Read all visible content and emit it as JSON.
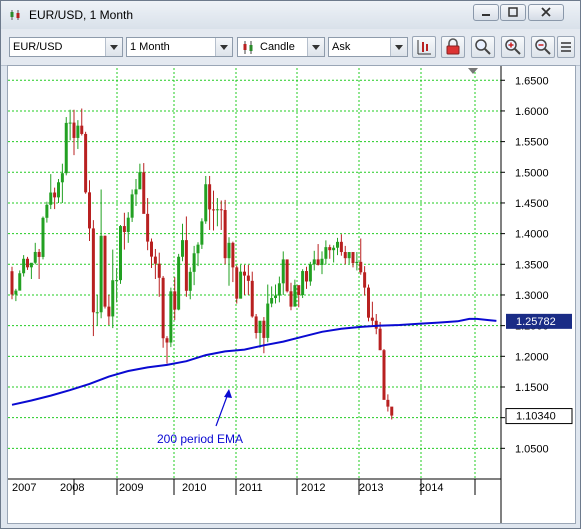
{
  "window": {
    "title": "EUR/USD,  1 Month"
  },
  "toolbar": {
    "instrument": "EUR/USD",
    "period": "1 Month",
    "chart_type": "Candle",
    "price_side": "Ask",
    "icons": [
      "candle-chart-icon",
      "lock-icon",
      "zoom-icon",
      "zoom-in-icon",
      "zoom-out-icon",
      "options-icon"
    ]
  },
  "colors": {
    "up": "#22a022",
    "down": "#b82020",
    "ema": "#0a0ad2",
    "grid": "#22cc22",
    "label_bg": "#1a2c86"
  },
  "chart_data": {
    "type": "candlestick",
    "instrument": "EUR/USD",
    "timeframe": "1 Month",
    "ylim": [
      1.0,
      1.67
    ],
    "yticks": [
      "1.6500",
      "1.6000",
      "1.5500",
      "1.5000",
      "1.4500",
      "1.4000",
      "1.3500",
      "1.3000",
      "1.2500",
      "1.2000",
      "1.1500",
      "1.1000",
      "1.0500"
    ],
    "xticks": [
      "2007",
      "2008",
      "2009",
      "2010",
      "2011",
      "2012",
      "2013",
      "2014"
    ],
    "grid": true,
    "current_price": "1.10340",
    "ema_value": "1.25782",
    "annotation": "200 period EMA",
    "candles": [
      [
        1.3387,
        1.346,
        1.293,
        1.3008
      ],
      [
        1.3008,
        1.31,
        1.29,
        1.3071
      ],
      [
        1.3071,
        1.34,
        1.31,
        1.3354
      ],
      [
        1.3354,
        1.365,
        1.33,
        1.359
      ],
      [
        1.359,
        1.362,
        1.341,
        1.3451
      ],
      [
        1.3451,
        1.352,
        1.326,
        1.3525
      ],
      [
        1.3525,
        1.385,
        1.35,
        1.3701
      ],
      [
        1.3701,
        1.375,
        1.326,
        1.362
      ],
      [
        1.362,
        1.428,
        1.358,
        1.4258
      ],
      [
        1.4258,
        1.452,
        1.418,
        1.447
      ],
      [
        1.447,
        1.497,
        1.44,
        1.467
      ],
      [
        1.467,
        1.475,
        1.44,
        1.4591
      ],
      [
        1.4591,
        1.489,
        1.45,
        1.4837
      ],
      [
        1.4837,
        1.514,
        1.45,
        1.4985
      ],
      [
        1.4985,
        1.59,
        1.495,
        1.5805
      ],
      [
        1.5805,
        1.602,
        1.552,
        1.581
      ],
      [
        1.581,
        1.602,
        1.528,
        1.556
      ],
      [
        1.556,
        1.585,
        1.538,
        1.576
      ],
      [
        1.576,
        1.604,
        1.56,
        1.5625
      ],
      [
        1.5625,
        1.566,
        1.465,
        1.4673
      ],
      [
        1.4673,
        1.487,
        1.388,
        1.4085
      ],
      [
        1.4085,
        1.422,
        1.233,
        1.2718
      ],
      [
        1.2718,
        1.3,
        1.25,
        1.2718
      ],
      [
        1.2718,
        1.472,
        1.262,
        1.3965
      ],
      [
        1.3965,
        1.397,
        1.278,
        1.281
      ],
      [
        1.281,
        1.3,
        1.251,
        1.265
      ],
      [
        1.265,
        1.374,
        1.246,
        1.324
      ],
      [
        1.324,
        1.344,
        1.288,
        1.3242
      ],
      [
        1.3242,
        1.414,
        1.318,
        1.4123
      ],
      [
        1.4123,
        1.434,
        1.374,
        1.4027
      ],
      [
        1.4027,
        1.435,
        1.385,
        1.426
      ],
      [
        1.426,
        1.472,
        1.419,
        1.464
      ],
      [
        1.464,
        1.489,
        1.445,
        1.4722
      ],
      [
        1.4722,
        1.514,
        1.473,
        1.5
      ],
      [
        1.5,
        1.515,
        1.44,
        1.4322
      ],
      [
        1.4322,
        1.458,
        1.373,
        1.387
      ],
      [
        1.387,
        1.392,
        1.344,
        1.3625
      ],
      [
        1.3625,
        1.375,
        1.326,
        1.351
      ],
      [
        1.351,
        1.369,
        1.297,
        1.328
      ],
      [
        1.328,
        1.331,
        1.214,
        1.2295
      ],
      [
        1.2295,
        1.233,
        1.188,
        1.2225
      ],
      [
        1.2225,
        1.312,
        1.215,
        1.3059
      ],
      [
        1.3059,
        1.329,
        1.259,
        1.2762
      ],
      [
        1.2762,
        1.367,
        1.275,
        1.3623
      ],
      [
        1.3623,
        1.416,
        1.355,
        1.3894
      ],
      [
        1.3894,
        1.428,
        1.297,
        1.3068
      ],
      [
        1.3068,
        1.345,
        1.293,
        1.3377
      ],
      [
        1.3377,
        1.38,
        1.316,
        1.368
      ],
      [
        1.368,
        1.386,
        1.347,
        1.382
      ],
      [
        1.382,
        1.425,
        1.375,
        1.42
      ],
      [
        1.42,
        1.494,
        1.416,
        1.4805
      ],
      [
        1.4805,
        1.494,
        1.406,
        1.4395
      ],
      [
        1.4395,
        1.47,
        1.405,
        1.439
      ],
      [
        1.439,
        1.458,
        1.412,
        1.4397
      ],
      [
        1.4397,
        1.454,
        1.406,
        1.4385
      ],
      [
        1.4385,
        1.455,
        1.35,
        1.36
      ],
      [
        1.36,
        1.394,
        1.315,
        1.385
      ],
      [
        1.385,
        1.387,
        1.321,
        1.345
      ],
      [
        1.345,
        1.348,
        1.286,
        1.294
      ],
      [
        1.294,
        1.349,
        1.295,
        1.338
      ],
      [
        1.338,
        1.349,
        1.3,
        1.3316
      ],
      [
        1.3316,
        1.349,
        1.3,
        1.323
      ],
      [
        1.323,
        1.338,
        1.263,
        1.265
      ],
      [
        1.265,
        1.269,
        1.229,
        1.238
      ],
      [
        1.238,
        1.244,
        1.214,
        1.258
      ],
      [
        1.258,
        1.264,
        1.205,
        1.23
      ],
      [
        1.23,
        1.317,
        1.223,
        1.286
      ],
      [
        1.286,
        1.314,
        1.28,
        1.295
      ],
      [
        1.295,
        1.317,
        1.286,
        1.299
      ],
      [
        1.299,
        1.33,
        1.288,
        1.319
      ],
      [
        1.319,
        1.371,
        1.3,
        1.358
      ],
      [
        1.358,
        1.347,
        1.304,
        1.306
      ],
      [
        1.306,
        1.32,
        1.275,
        1.281
      ],
      [
        1.281,
        1.325,
        1.282,
        1.316
      ],
      [
        1.316,
        1.311,
        1.28,
        1.3
      ],
      [
        1.3,
        1.342,
        1.295,
        1.339
      ],
      [
        1.339,
        1.346,
        1.31,
        1.322
      ],
      [
        1.322,
        1.354,
        1.315,
        1.35
      ],
      [
        1.35,
        1.372,
        1.34,
        1.358
      ],
      [
        1.358,
        1.383,
        1.348,
        1.349
      ],
      [
        1.349,
        1.371,
        1.334,
        1.359
      ],
      [
        1.359,
        1.389,
        1.35,
        1.378
      ],
      [
        1.378,
        1.382,
        1.359,
        1.373
      ],
      [
        1.373,
        1.381,
        1.353,
        1.377
      ],
      [
        1.377,
        1.393,
        1.365,
        1.3866
      ],
      [
        1.3866,
        1.399,
        1.364,
        1.37
      ],
      [
        1.37,
        1.38,
        1.35,
        1.36
      ],
      [
        1.36,
        1.365,
        1.351,
        1.37
      ],
      [
        1.37,
        1.37,
        1.345,
        1.352
      ],
      [
        1.352,
        1.37,
        1.34,
        1.354
      ],
      [
        1.354,
        1.392,
        1.333,
        1.337
      ],
      [
        1.337,
        1.347,
        1.299,
        1.312
      ],
      [
        1.312,
        1.317,
        1.257,
        1.263
      ],
      [
        1.263,
        1.289,
        1.25,
        1.258
      ],
      [
        1.258,
        1.269,
        1.236,
        1.245
      ],
      [
        1.245,
        1.256,
        1.21,
        1.21
      ],
      [
        1.21,
        1.212,
        1.13,
        1.129
      ],
      [
        1.129,
        1.138,
        1.11,
        1.118
      ],
      [
        1.118,
        1.116,
        1.097,
        1.1034
      ]
    ],
    "ema": [
      [
        0,
        1.121
      ],
      [
        5,
        1.128
      ],
      [
        10,
        1.136
      ],
      [
        15,
        1.145
      ],
      [
        20,
        1.155
      ],
      [
        25,
        1.167
      ],
      [
        30,
        1.176
      ],
      [
        35,
        1.182
      ],
      [
        40,
        1.186
      ],
      [
        45,
        1.192
      ],
      [
        50,
        1.202
      ],
      [
        55,
        1.208
      ],
      [
        60,
        1.211
      ],
      [
        65,
        1.218
      ],
      [
        70,
        1.224
      ],
      [
        75,
        1.232
      ],
      [
        80,
        1.24
      ],
      [
        85,
        1.245
      ],
      [
        90,
        1.248
      ],
      [
        95,
        1.25
      ],
      [
        100,
        1.251
      ],
      [
        105,
        1.253
      ],
      [
        110,
        1.255
      ],
      [
        115,
        1.257
      ],
      [
        118,
        1.261
      ],
      [
        120,
        1.261
      ],
      [
        123,
        1.259
      ],
      [
        125,
        1.2578
      ]
    ]
  }
}
